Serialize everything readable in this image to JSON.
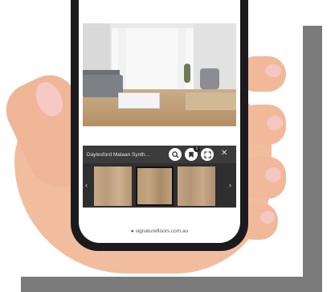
{
  "viewer": {
    "product_title": "Daylesford Malaan Synth...",
    "save_badge_count": "1",
    "close_symbol": "✕"
  },
  "footer": {
    "url": "● signaturefloors.com.au"
  },
  "icons": {
    "search": "search-icon",
    "save": "save-icon",
    "expand": "expand-icon",
    "close": "close-icon",
    "prev": "chevron-left-icon",
    "next": "chevron-right-icon"
  },
  "colors": {
    "toolbar_bg": "#3b3b3b",
    "strip_bg": "#2f2f2f",
    "frame_gray": "#7b7b7b",
    "phone_body": "#1b1b1d"
  }
}
